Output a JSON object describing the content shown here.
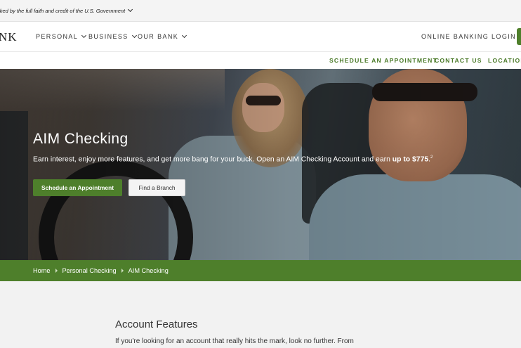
{
  "gov_banner": {
    "text": "cked by the full faith and credit of the U.S. Government"
  },
  "logo": {
    "text": "NK"
  },
  "main_nav": {
    "items": [
      {
        "label": "PERSONAL"
      },
      {
        "label": "BUSINESS"
      },
      {
        "label": "OUR BANK"
      }
    ],
    "login_label": "ONLINE BANKING LOGIN"
  },
  "sub_nav": {
    "schedule": "SCHEDULE AN APPOINTMENT",
    "contact": "CONTACT US",
    "locations": "LOCATION"
  },
  "hero": {
    "title": "AIM Checking",
    "desc_prefix": "Earn interest, enjoy more features, and get more bang for your buck. Open an AIM Checking Account and earn ",
    "desc_bold": "up to $775",
    "desc_suffix": ".",
    "footnote": "2",
    "primary_button": "Schedule an Appointment",
    "secondary_button": "Find a Branch"
  },
  "breadcrumb": {
    "items": [
      "Home",
      "Personal Checking",
      "AIM Checking"
    ]
  },
  "content": {
    "title": "Account Features",
    "text": "If you're looking for an account that really hits the mark, look no further. From"
  },
  "colors": {
    "brand_green": "#4e7f2b",
    "link_green": "#4a7a28"
  }
}
